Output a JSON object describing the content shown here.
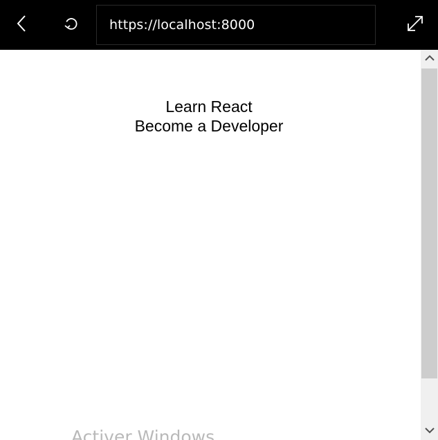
{
  "toolbar": {
    "back_icon": "chevron-left-icon",
    "reload_icon": "refresh-icon",
    "expand_icon": "expand-diagonal-icon",
    "url": "https://localhost:8000",
    "background_color": "#000000",
    "text_color": "#ffffff"
  },
  "page": {
    "line1": "Learn React",
    "line2": "Become a Developer"
  },
  "watermark": {
    "text": "Activer Windows"
  },
  "scrollbar": {
    "up_icon": "chevron-up-icon",
    "down_icon": "chevron-down-icon",
    "track_color": "#f0f0f0",
    "thumb_color": "#cdcdcd"
  }
}
